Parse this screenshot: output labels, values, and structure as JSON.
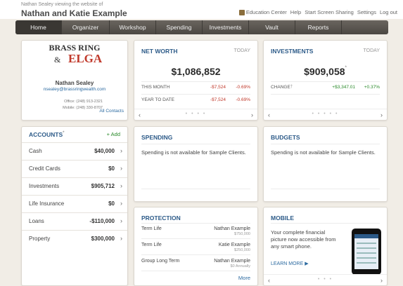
{
  "header": {
    "viewing": "Nathan Sealey viewing the website of",
    "client": "Nathan and Katie Example",
    "links": [
      "Education Center",
      "Help",
      "Start Screen Sharing",
      "Settings",
      "Log out"
    ]
  },
  "nav": [
    "Home",
    "Organizer",
    "Workshop",
    "Spending",
    "Investments",
    "Vault",
    "Reports"
  ],
  "advisor": {
    "logo_top": "BRASS RING",
    "logo_amp": "&",
    "logo_mid": "ELGA",
    "name": "Nathan Sealey",
    "email": "nsealey@brassringwealth.com",
    "office": "Office: (248) 913-2321",
    "mobile": "Mobile: (248) 330-8707",
    "all_contacts": "All Contacts"
  },
  "networth": {
    "title": "NET WORTH",
    "today": "TODAY",
    "value": "$1,086,852",
    "rows": [
      {
        "label": "THIS MONTH",
        "amount": "-$7,524",
        "pct": "-0.69%"
      },
      {
        "label": "YEAR TO DATE",
        "amount": "-$7,524",
        "pct": "-0.69%"
      }
    ],
    "dots": "• • • •"
  },
  "investments": {
    "title": "INVESTMENTS",
    "today": "TODAY",
    "value": "$909,058",
    "change_label": "CHANGE",
    "change_amount": "+$3,347.01",
    "change_pct": "+0.37%",
    "dots": "• • • • •"
  },
  "accounts": {
    "title": "ACCOUNTS",
    "add": "+ Add",
    "items": [
      {
        "name": "Cash",
        "value": "$40,000"
      },
      {
        "name": "Credit Cards",
        "value": "$0"
      },
      {
        "name": "Investments",
        "value": "$905,712"
      },
      {
        "name": "Life Insurance",
        "value": "$0"
      },
      {
        "name": "Loans",
        "value": "-$110,000"
      },
      {
        "name": "Property",
        "value": "$300,000"
      }
    ]
  },
  "spending": {
    "title": "SPENDING",
    "message": "Spending is not available for Sample Clients."
  },
  "budgets": {
    "title": "BUDGETS",
    "message": "Spending is not available for Sample Clients."
  },
  "protection": {
    "title": "PROTECTION",
    "rows": [
      {
        "type": "Term Life",
        "who": "Nathan Example",
        "amount": "$750,000"
      },
      {
        "type": "Term Life",
        "who": "Katie Example",
        "amount": "$250,000"
      },
      {
        "type": "Group Long Term",
        "who": "Nathan Example",
        "amount": "$0 Annually"
      }
    ],
    "more": "More"
  },
  "mobile": {
    "title": "MOBILE",
    "text_lines": [
      "Your complete financial",
      "picture now accessible from",
      "any smart phone."
    ],
    "learn_more": "LEARN MORE ▶",
    "dots": "• • •"
  },
  "icons": {
    "chevron_right": "›",
    "chevron_left": "‹"
  }
}
